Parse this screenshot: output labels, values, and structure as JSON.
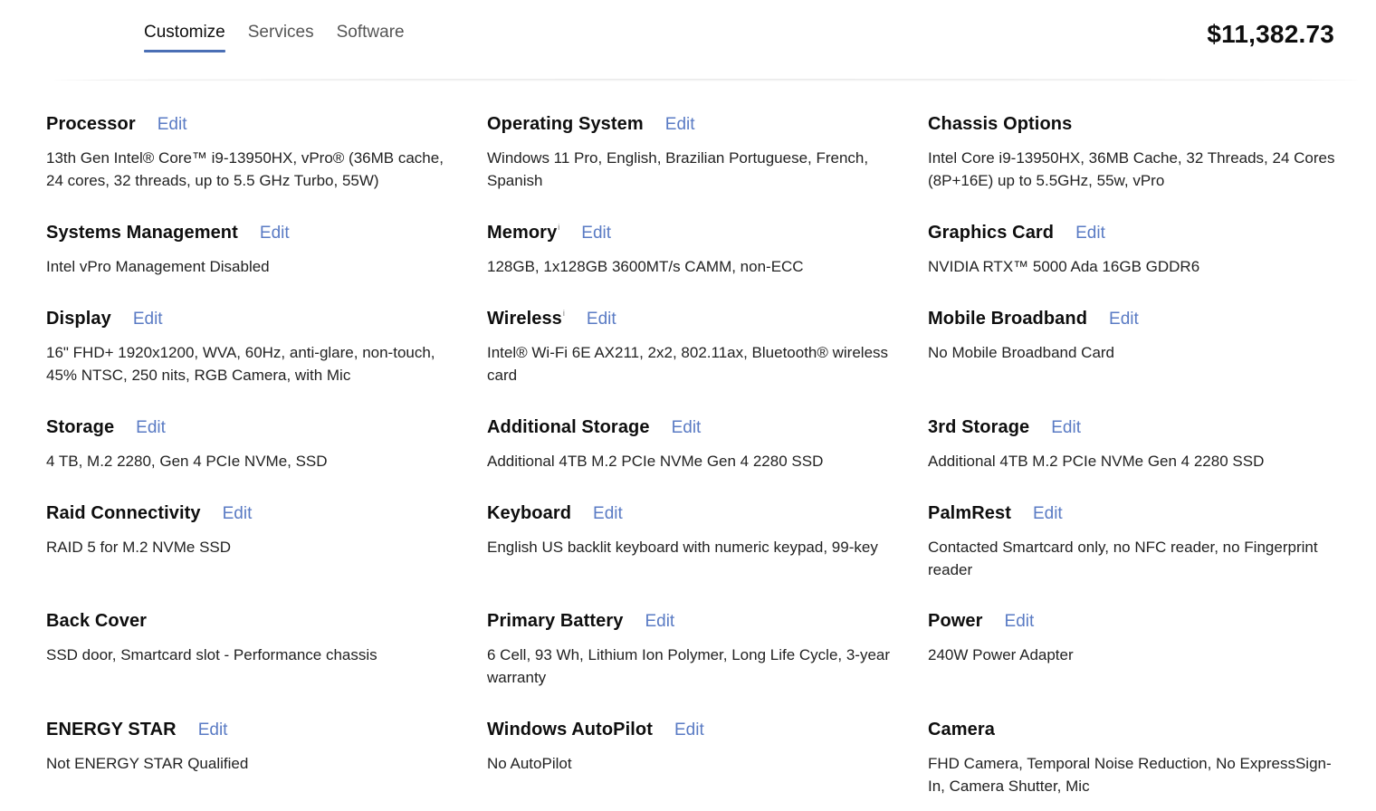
{
  "tabs": {
    "customize": "Customize",
    "services": "Services",
    "software": "Software"
  },
  "price": "$11,382.73",
  "edit_label": "Edit",
  "info_mark": "i",
  "colors": {
    "accent": "#4a6fb5",
    "link": "#5a7bc4",
    "text": "#0e0e0e"
  },
  "specs": [
    {
      "title": "Processor",
      "value": "13th Gen Intel® Core™ i9-13950HX, vPro® (36MB cache, 24 cores, 32 threads, up to 5.5 GHz Turbo, 55W)",
      "edit": true,
      "info": false
    },
    {
      "title": "Operating System",
      "value": "Windows 11 Pro, English, Brazilian Portuguese, French, Spanish",
      "edit": true,
      "info": false
    },
    {
      "title": "Chassis Options",
      "value": "Intel Core i9-13950HX, 36MB Cache, 32 Threads, 24 Cores (8P+16E) up to 5.5GHz, 55w, vPro",
      "edit": false,
      "info": false
    },
    {
      "title": "Systems Management",
      "value": "Intel vPro Management Disabled",
      "edit": true,
      "info": false
    },
    {
      "title": "Memory",
      "value": "128GB, 1x128GB 3600MT/s CAMM, non-ECC",
      "edit": true,
      "info": true
    },
    {
      "title": "Graphics Card",
      "value": "NVIDIA RTX™ 5000 Ada 16GB GDDR6",
      "edit": true,
      "info": false
    },
    {
      "title": "Display",
      "value": "16\" FHD+ 1920x1200, WVA, 60Hz, anti-glare, non-touch, 45% NTSC, 250 nits, RGB Camera, with Mic",
      "edit": true,
      "info": false
    },
    {
      "title": "Wireless",
      "value": "Intel® Wi-Fi 6E AX211, 2x2, 802.11ax, Bluetooth® wireless card",
      "edit": true,
      "info": true
    },
    {
      "title": "Mobile Broadband",
      "value": "No Mobile Broadband Card",
      "edit": true,
      "info": false
    },
    {
      "title": "Storage",
      "value": "4 TB, M.2 2280, Gen 4 PCIe NVMe, SSD",
      "edit": true,
      "info": false
    },
    {
      "title": "Additional Storage",
      "value": "Additional 4TB M.2 PCIe NVMe Gen 4 2280 SSD",
      "edit": true,
      "info": false
    },
    {
      "title": "3rd Storage",
      "value": "Additional 4TB M.2 PCIe NVMe Gen 4 2280 SSD",
      "edit": true,
      "info": false
    },
    {
      "title": "Raid Connectivity",
      "value": "RAID 5 for M.2 NVMe SSD",
      "edit": true,
      "info": false
    },
    {
      "title": "Keyboard",
      "value": "English US backlit keyboard with numeric keypad, 99-key",
      "edit": true,
      "info": false
    },
    {
      "title": "PalmRest",
      "value": "Contacted Smartcard only, no NFC reader, no Fingerprint reader",
      "edit": true,
      "info": false
    },
    {
      "title": "Back Cover",
      "value": "SSD door, Smartcard slot - Performance chassis",
      "edit": false,
      "info": false
    },
    {
      "title": "Primary Battery",
      "value": "6 Cell, 93 Wh, Lithium Ion Polymer, Long Life Cycle, 3-year warranty",
      "edit": true,
      "info": false
    },
    {
      "title": "Power",
      "value": "240W Power Adapter",
      "edit": true,
      "info": false
    },
    {
      "title": "ENERGY STAR",
      "value": "Not ENERGY STAR Qualified",
      "edit": true,
      "info": false
    },
    {
      "title": "Windows AutoPilot",
      "value": "No AutoPilot",
      "edit": true,
      "info": false
    },
    {
      "title": "Camera",
      "value": "FHD Camera, Temporal Noise Reduction, No ExpressSign-In, Camera Shutter, Mic",
      "edit": false,
      "info": false
    }
  ]
}
